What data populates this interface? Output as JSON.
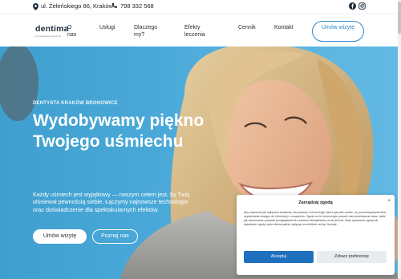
{
  "topbar": {
    "address": "ul. Żeleńskiego 86, Kraków",
    "phone": "798 332 568",
    "icons": [
      "location-pin-icon",
      "phone-icon",
      "facebook-icon",
      "instagram-icon"
    ]
  },
  "nav": {
    "logo": "dentima",
    "logo_tagline": "stomatologia estetyczna",
    "items": [
      {
        "label": "O nas"
      },
      {
        "label": "Usługi"
      },
      {
        "label": "Dlaczego my?"
      },
      {
        "label": "Efekty leczenia"
      },
      {
        "label": "Cennik"
      },
      {
        "label": "Kontakt"
      }
    ],
    "cta": "Umów wizytę"
  },
  "hero": {
    "eyebrow": "DENTYSTA KRAKÓW BRONOWICE",
    "headline": "Wydobywamy piękno Twojego uśmiechu",
    "lead": "Każdy uśmiech jest wyjątkowy — naszym celem jest, by Twój olśniewał pewnością siebie. Łączymy najnowsze technologie oraz doświadczenie dla spektakularnych efektów.",
    "primary_button": "Umów wizytę",
    "secondary_button": "Poznaj nas"
  },
  "consent": {
    "title": "Zarządzaj zgodą",
    "close": "×",
    "text": "Aby zapewnić jak najlepsze wrażenia, korzystamy z technologii, takich jak pliki cookie, do przechowywania i/lub uzyskiwania dostępu do informacji o urządzeniu. Zgoda na te technologie pozwoli nam przetwarzać dane, takie jak zachowanie podczas przeglądania lub unikalne identyfikatory na tej stronie. Brak wyrażenia zgody lub wycofanie zgody może niekorzystnie wpłynąć na niektóre cechy i funkcje.",
    "accept": "Akceptuj",
    "preferences": "Zobacz preferencje"
  },
  "colors": {
    "accent": "#2e86c8",
    "hero_bg": "#4aa9d8",
    "accept_button": "#1f6fbf"
  }
}
